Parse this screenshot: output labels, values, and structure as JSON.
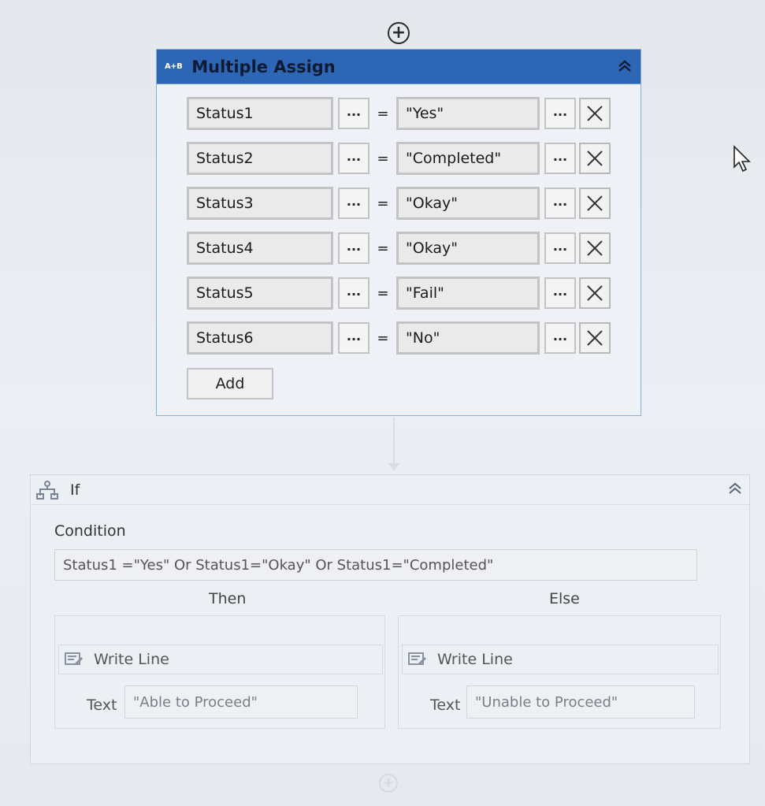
{
  "assign": {
    "title": "Multiple Assign",
    "icon_text": "A+B",
    "add_label": "Add",
    "rows": [
      {
        "to": "Status1",
        "value": "\"Yes\""
      },
      {
        "to": "Status2",
        "value": "\"Completed\""
      },
      {
        "to": "Status3",
        "value": "\"Okay\""
      },
      {
        "to": "Status4",
        "value": "\"Okay\""
      },
      {
        "to": "Status5",
        "value": "\"Fail\""
      },
      {
        "to": "Status6",
        "value": "\"No\""
      }
    ],
    "dots_label": "...",
    "eq_label": "="
  },
  "if_activity": {
    "title": "If",
    "condition_label": "Condition",
    "condition_value": "Status1 =\"Yes\" Or Status1=\"Okay\" Or Status1=\"Completed\"",
    "then_label": "Then",
    "else_label": "Else",
    "then_branch": {
      "activity_title": "Write Line",
      "text_label": "Text",
      "text_value": "\"Able to Proceed\""
    },
    "else_branch": {
      "activity_title": "Write Line",
      "text_label": "Text",
      "text_value": "\"Unable to Proceed\""
    }
  },
  "icons": {
    "top_add": "plus-circle-icon",
    "bottom_add": "plus-circle-icon",
    "collapse": "double-chevron-up-icon",
    "delete": "close-icon",
    "if": "if-branch-icon",
    "write_line": "write-line-icon",
    "cursor": "mouse-pointer-icon"
  },
  "colors": {
    "header_blue": "#2d66b5",
    "card_border": "#8aaedb"
  }
}
